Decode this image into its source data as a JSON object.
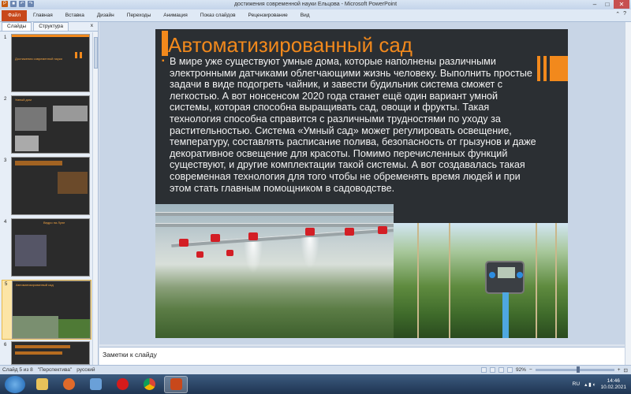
{
  "window": {
    "title": "достижения современной науки Ельцова - Microsoft PowerPoint"
  },
  "ribbon": {
    "file_tab": "Файл",
    "tabs": [
      "Главная",
      "Вставка",
      "Дизайн",
      "Переходы",
      "Анимация",
      "Показ слайдов",
      "Рецензирование",
      "Вид"
    ]
  },
  "panel": {
    "tabs": [
      "Слайды",
      "Структура"
    ],
    "close": "x",
    "slides": [
      {
        "num": "1",
        "title": "Достижения современной науки"
      },
      {
        "num": "2",
        "title": "Умный дом"
      },
      {
        "num": "3",
        "title": ""
      },
      {
        "num": "4",
        "title": "Ведро на Луне"
      },
      {
        "num": "5",
        "title": "Автоматизированный сад"
      },
      {
        "num": "6",
        "title": ""
      }
    ]
  },
  "slide": {
    "title": "Автоматизированный сад",
    "body": "В мире уже существуют умные дома, которые наполнены различными электронными датчиками облегчающими жизнь человеку. Выполнить простые задачи в виде подогреть чайник, и завести будильник система сможет с легкостью. А вот нонсенсом 2020 года станет ещё один вариант умной системы, которая способна выращивать сад, овощи и фрукты. Такая технология способна справится с различными трудностями по уходу за растительностью. Система «Умный сад» может регулировать освещение, температуру, составлять расписание полива, безопасность от грызунов и даже декоративное освещение для красоты. Помимо перечисленных функций существуют, и другие комплектации такой системы. А вот создавалась такая современная технология для того чтобы не обременять время людей и при этом стать главным помощником в садоводстве.",
    "bullet": "▪"
  },
  "notes": {
    "placeholder": "Заметки к слайду"
  },
  "status": {
    "slide_info": "Слайд 5 из 8",
    "theme": "\"Перспектива\"",
    "language": "русский",
    "zoom": "92%"
  },
  "taskbar": {
    "lang": "RU",
    "time": "14:46",
    "date": "10.02.2021"
  },
  "colors": {
    "accent": "#f2891c",
    "slide_bg": "#2b2f33",
    "file_tab": "#c8481b"
  }
}
